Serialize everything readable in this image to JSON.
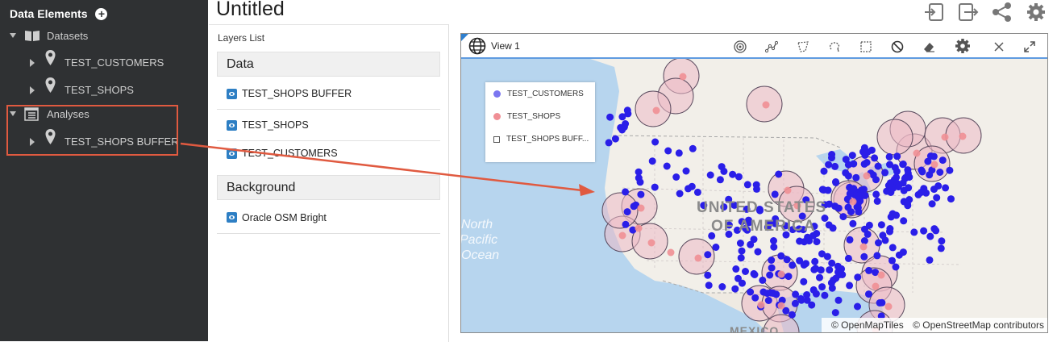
{
  "sidebar": {
    "title": "Data Elements",
    "datasets": {
      "label": "Datasets",
      "items": [
        {
          "label": "TEST_CUSTOMERS"
        },
        {
          "label": "TEST_SHOPS"
        }
      ]
    },
    "analyses": {
      "label": "Analyses",
      "items": [
        {
          "label": "TEST_SHOPS BUFFER"
        }
      ]
    }
  },
  "header": {
    "title": "Untitled"
  },
  "layers": {
    "label": "Layers List",
    "data_group": "Data",
    "data_items": [
      {
        "label": "TEST_SHOPS BUFFER"
      },
      {
        "label": "TEST_SHOPS"
      },
      {
        "label": "TEST_CUSTOMERS"
      }
    ],
    "background_group": "Background",
    "background_items": [
      {
        "label": "Oracle OSM Bright"
      }
    ]
  },
  "view": {
    "title": "View 1",
    "legend": [
      {
        "label": "TEST_CUSTOMERS",
        "color": "#7b76f0"
      },
      {
        "label": "TEST_SHOPS",
        "color": "#f08f95"
      },
      {
        "label": "TEST_SHOPS BUFF..."
      }
    ],
    "map_labels": {
      "country_line1": "UNITED STATES",
      "country_line2": "OF AMERICA",
      "ocean_line1": "North",
      "ocean_line2": "Pacific",
      "ocean_line3": "Ocean",
      "mexico": "MEXICO"
    },
    "attribution": {
      "tiles": "© OpenMapTiles",
      "osm": "© OpenStreetMap contributors"
    }
  },
  "colors": {
    "sidebar_bg": "#2f3133",
    "accent": "#2e7fc4",
    "highlight": "#e05a40",
    "customer_dot": "#2a1ee8"
  }
}
